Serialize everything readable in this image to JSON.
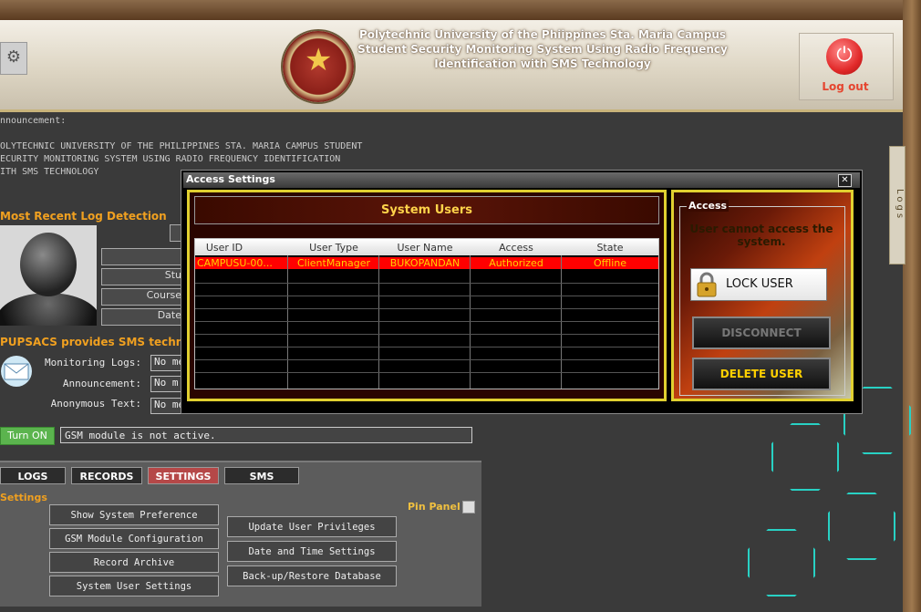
{
  "header": {
    "title_line1": "Polytechnic University of the Phiippines Sta. Maria Campus",
    "title_line2": "Student Security Monitoring System Using Radio Frequency",
    "title_line3": "Identification with SMS Technology",
    "logout_label": "Log out"
  },
  "announcement": {
    "label": "nnouncement:",
    "line1": "OLYTECHNIC UNIVERSITY OF THE PHILIPPINES STA. MARIA CAMPUS STUDENT",
    "line2": "ECURITY MONITORING SYSTEM USING RADIO FREQUENCY IDENTIFICATION",
    "line3": "ITH SMS TECHNOLOGY"
  },
  "log_detection": {
    "title": "Most Recent Log Detection",
    "fields": [
      "Stu",
      "Course",
      "Date"
    ]
  },
  "sms": {
    "title": "PUPSACS provides SMS techn",
    "rows": [
      {
        "label": "Monitoring Logs:",
        "value": "No me"
      },
      {
        "label": "Announcement:",
        "value": "No m"
      },
      {
        "label": "Anonymous Text:",
        "value": "No messages."
      }
    ],
    "turn_on_label": "Turn ON",
    "gsm_status": "GSM module is not active."
  },
  "tabs": [
    "LOGS",
    "RECORDS",
    "SETTINGS",
    "SMS"
  ],
  "active_tab": "SETTINGS",
  "settings": {
    "label": "Settings",
    "left_buttons": [
      "Show System Preference",
      "GSM Module Configuration",
      "Record Archive",
      "System User Settings"
    ],
    "right_buttons": [
      "Update User Privileges",
      "Date and Time Settings",
      "Back-up/Restore Database"
    ],
    "pin_panel_label": "Pin Panel"
  },
  "side_tab": "Logs",
  "dialog": {
    "title": "Access Settings",
    "close_symbol": "✕",
    "users_header": "System Users",
    "columns": [
      "User ID",
      "User Type",
      "User Name",
      "Access",
      "State"
    ],
    "rows": [
      [
        "CAMPUSU-00...",
        "ClientManager",
        "BUKOPANDAN",
        "Authorized",
        "Offline"
      ]
    ],
    "access": {
      "group_title": "Access",
      "message": "User cannot access the system.",
      "lock_label": "LOCK USER",
      "disconnect_label": "DISCONNECT",
      "delete_label": "DELETE USER"
    }
  },
  "colors": {
    "accent_orange": "#f0a020",
    "selected_row": "#ff0000",
    "row_text": "#ffd000",
    "active_tab": "#b54848",
    "dialog_frame": "#e0d030"
  },
  "icons": [
    "logo-icon",
    "seal-icon",
    "power-icon",
    "avatar-icon",
    "envelope-icon",
    "lock-icon",
    "close-icon",
    "checkbox-icon"
  ]
}
